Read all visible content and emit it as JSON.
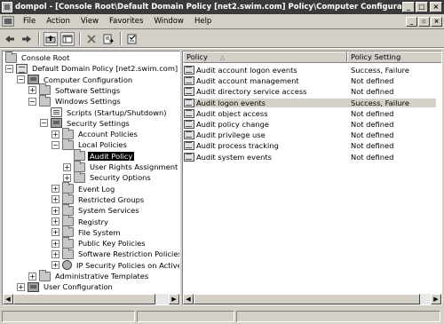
{
  "window": {
    "title": "dompol - [Console Root\\Default Domain Policy [net2.swim.com] Policy\\Computer Configuration\\Window..."
  },
  "menu": [
    "File",
    "Action",
    "View",
    "Favorites",
    "Window",
    "Help"
  ],
  "toolbar": {
    "buttons": [
      "back-icon",
      "forward-icon",
      "up-folder-icon",
      "show-tree-icon",
      "delete-icon",
      "export-list-icon",
      "properties-icon"
    ]
  },
  "tree": [
    {
      "label": "Console Root",
      "icon": "console-icon",
      "level": 0,
      "expander": "none"
    },
    {
      "label": "Default Domain Policy [net2.swim.com] Policy",
      "icon": "policy-icon",
      "level": 0,
      "expander": "minus"
    },
    {
      "label": "Computer Configuration",
      "icon": "computer-icon",
      "level": 1,
      "expander": "minus"
    },
    {
      "label": "Software Settings",
      "icon": "folder-icon",
      "level": 2,
      "expander": "plus"
    },
    {
      "label": "Windows Settings",
      "icon": "folder-icon",
      "level": 2,
      "expander": "minus"
    },
    {
      "label": "Scripts (Startup/Shutdown)",
      "icon": "script-icon",
      "level": 3,
      "expander": "none"
    },
    {
      "label": "Security Settings",
      "icon": "security-icon",
      "level": 3,
      "expander": "minus"
    },
    {
      "label": "Account Policies",
      "icon": "folder-icon",
      "level": 4,
      "expander": "plus"
    },
    {
      "label": "Local Policies",
      "icon": "folder-icon",
      "level": 4,
      "expander": "minus"
    },
    {
      "label": "Audit Policy",
      "icon": "folder-icon",
      "level": 5,
      "expander": "none",
      "selected": true
    },
    {
      "label": "User Rights Assignment",
      "icon": "folder-icon",
      "level": 5,
      "expander": "plus"
    },
    {
      "label": "Security Options",
      "icon": "folder-icon",
      "level": 5,
      "expander": "plus"
    },
    {
      "label": "Event Log",
      "icon": "folder-icon",
      "level": 4,
      "expander": "plus"
    },
    {
      "label": "Restricted Groups",
      "icon": "folder-icon",
      "level": 4,
      "expander": "plus"
    },
    {
      "label": "System Services",
      "icon": "folder-icon",
      "level": 4,
      "expander": "plus"
    },
    {
      "label": "Registry",
      "icon": "folder-icon",
      "level": 4,
      "expander": "plus"
    },
    {
      "label": "File System",
      "icon": "folder-icon",
      "level": 4,
      "expander": "plus"
    },
    {
      "label": "Public Key Policies",
      "icon": "folder-icon",
      "level": 4,
      "expander": "plus"
    },
    {
      "label": "Software Restriction Policies",
      "icon": "folder-icon",
      "level": 4,
      "expander": "plus"
    },
    {
      "label": "IP Security Policies on Active Dir",
      "icon": "ip-security-icon",
      "level": 4,
      "expander": "plus"
    },
    {
      "label": "Administrative Templates",
      "icon": "folder-icon",
      "level": 2,
      "expander": "plus"
    },
    {
      "label": "User Configuration",
      "icon": "user-icon",
      "level": 1,
      "expander": "plus"
    }
  ],
  "list": {
    "columns": [
      "Policy",
      "Policy Setting"
    ],
    "sort_indicator": "△",
    "rows": [
      {
        "policy": "Audit account logon events",
        "setting": "Success, Failure"
      },
      {
        "policy": "Audit account management",
        "setting": "Not defined"
      },
      {
        "policy": "Audit directory service access",
        "setting": "Not defined"
      },
      {
        "policy": "Audit logon events",
        "setting": "Success, Failure",
        "selected": true
      },
      {
        "policy": "Audit object access",
        "setting": "Not defined"
      },
      {
        "policy": "Audit policy change",
        "setting": "Not defined"
      },
      {
        "policy": "Audit privilege use",
        "setting": "Not defined"
      },
      {
        "policy": "Audit process tracking",
        "setting": "Not defined"
      },
      {
        "policy": "Audit system events",
        "setting": "Not defined"
      }
    ]
  }
}
